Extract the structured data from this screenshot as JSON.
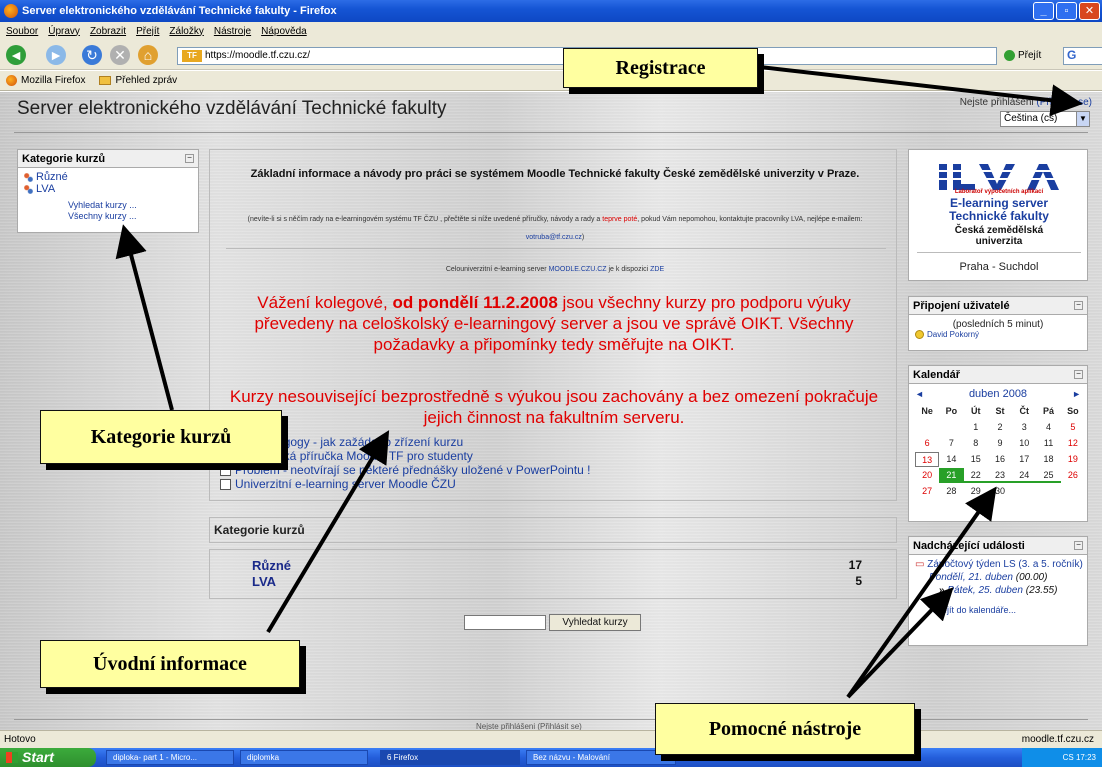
{
  "browser": {
    "title": "Server elektronického vzdělávání Technické fakulty - Firefox",
    "menu": [
      "Soubor",
      "Úpravy",
      "Zobrazit",
      "Přejít",
      "Záložky",
      "Nástroje",
      "Nápověda"
    ],
    "url": "https://moodle.tf.czu.cz/",
    "site_icon_text": "TF",
    "go_label": "Přejít",
    "search_engine_glyph": "G",
    "bookmarks": [
      "Mozilla Firefox",
      "Přehled zpráv"
    ],
    "status_left": "Hotovo",
    "status_right": "moodle.tf.czu.cz"
  },
  "header": {
    "site_title": "Server elektronického vzdělávání Technické fakulty",
    "login_prefix": "Nejste přihlášeni",
    "login_link": "(Přihlásit se)",
    "language": "Čeština (cs)"
  },
  "category_block": {
    "title": "Kategorie kurzů",
    "items": [
      "Různé",
      "LVA"
    ],
    "links": [
      "Vyhledat kurzy ...",
      "Všechny kurzy ..."
    ]
  },
  "intro": {
    "heading": "Základní informace a návody pro práci se systémem Moodle Technické fakulty České zemědělské univerzity v Praze.",
    "small_1": "(nevíte-li si s něčím rady na e-learningovém systému TF ČZU , přečtěte si níže uvedené příručky, návody a rady a",
    "small_red": "teprve poté",
    "small_2": ", pokud Vám nepomohou, kontaktujte pracovníky LVA, nejlépe e-mailem:",
    "email": "votruba@tf.czu.cz",
    "small_3": ")",
    "univ_text": "Celouniverzitní e-learning server",
    "univ_link": "MOODLE.CZU.CZ",
    "univ_text_2": "je k dispozici",
    "univ_here": "ZDE",
    "red_1a": "Vážení kolegové,",
    "red_1b": "od pondělí 11.2.2008",
    "red_1c": "jsou všechny kurzy pro podporu výuky převedeny na celoškolský e-learningový server a jsou ve správě OIKT. Všechny požadavky a připomínky tedy směřujte na OIKT.",
    "red_2": "Kurzy nesouvisející bezprostředně s výukou jsou zachovány a bez omezení pokračuje jejich činnost na fakultním serveru.",
    "resources": [
      "Pro pedagogy - jak zažádat o zřízení kurzu",
      "Uživatelská příručka Moodle TF pro studenty",
      "Problém - neotvírají se některé přednášky uložené v PowerPointu !",
      "Univerzitní e-learning server Moodle ČZU"
    ]
  },
  "course_categories": {
    "title": "Kategorie kurzů",
    "rows": [
      {
        "name": "Různé",
        "count": "17"
      },
      {
        "name": "LVA",
        "count": "5"
      }
    ],
    "search_button": "Vyhledat kurzy"
  },
  "logo_block": {
    "logo_text": "ILVA",
    "logo_sub": "Laboratoř výpočetních aplikací",
    "line1": "E-learning server",
    "line2": "Technické fakulty",
    "line3": "Česká zemědělská",
    "line4": "univerzita",
    "place": "Praha - Suchdol"
  },
  "online_block": {
    "title": "Připojení uživatelé",
    "subtitle": "(posledních 5 minut)",
    "user": "David Pokorný"
  },
  "calendar": {
    "title": "Kalendář",
    "month": "duben 2008",
    "prev": "◄",
    "next": "►",
    "weekdays": [
      "Ne",
      "Po",
      "Út",
      "St",
      "Čt",
      "Pá",
      "So"
    ],
    "weeks": [
      [
        "",
        "",
        "1",
        "2",
        "3",
        "4",
        "5"
      ],
      [
        "6",
        "7",
        "8",
        "9",
        "10",
        "11",
        "12"
      ],
      [
        "13",
        "14",
        "15",
        "16",
        "17",
        "18",
        "19"
      ],
      [
        "20",
        "21",
        "22",
        "23",
        "24",
        "25",
        "26"
      ],
      [
        "27",
        "28",
        "29",
        "30",
        "",
        "",
        ""
      ]
    ],
    "today": "13",
    "event_day": "21",
    "event_span": [
      "22",
      "23",
      "24",
      "25"
    ]
  },
  "events_block": {
    "title": "Nadcházející události",
    "event_title": "Zápočtový týden LS (3. a 5. ročník)",
    "date1": "Pondělí, 21. duben",
    "time1": "(00.00)",
    "arrow": "»",
    "date2": "Pátek, 25. duben",
    "time2": "(23.55)",
    "footer_link": "Přejít do kalendáře..."
  },
  "footer": {
    "text": "Nejste přihlášeni (Přihlásit se)"
  },
  "taskbar": {
    "start": "Start",
    "tasks": [
      "diploka- part 1 - Micro...",
      "diplomka",
      "6 Firefox",
      "Bez názvu - Malování"
    ],
    "tray_lang": "CS",
    "clock": "17:23"
  },
  "annotations": {
    "registrace": "Registrace",
    "kategorie": "Kategorie kurzů",
    "uvodni": "Úvodní informace",
    "pomocne": "Pomocné nástroje"
  },
  "colors": {
    "link": "#1a3ea0",
    "alert_red": "#e00000",
    "callout_fill": "#ffffa0",
    "calendar_event": "#28a028"
  }
}
